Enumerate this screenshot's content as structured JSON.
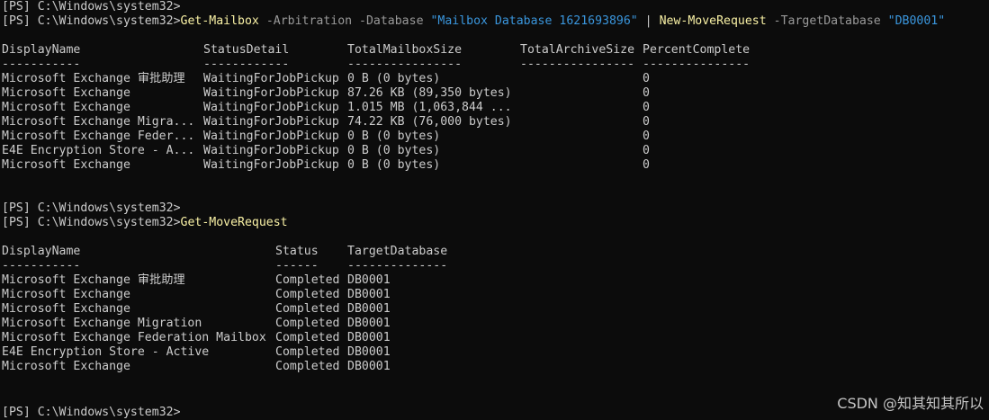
{
  "prompt": {
    "ps_tag": "[PS]",
    "path": "C:\\Windows\\system32>"
  },
  "command1": {
    "cmdlet1": "Get-Mailbox",
    "param1": "-Arbitration",
    "param2": "-Database",
    "arg1": "\"Mailbox Database 1621693896\"",
    "pipe": "|",
    "cmdlet2": "New-MoveRequest",
    "param3": "-TargetDatabase",
    "arg2": "\"DB0001\""
  },
  "table1": {
    "headers": [
      "DisplayName",
      "StatusDetail",
      "TotalMailboxSize",
      "TotalArchiveSize",
      "PercentComplete"
    ],
    "separators": [
      "-----------",
      "------------",
      "----------------",
      "----------------",
      "---------------"
    ],
    "rows": [
      [
        "Microsoft Exchange 审批助理",
        "WaitingForJobPickup",
        "0 B (0 bytes)",
        "",
        "0"
      ],
      [
        "Microsoft Exchange",
        "WaitingForJobPickup",
        "87.26 KB (89,350 bytes)",
        "",
        "0"
      ],
      [
        "Microsoft Exchange",
        "WaitingForJobPickup",
        "1.015 MB (1,063,844 ...",
        "",
        "0"
      ],
      [
        "Microsoft Exchange Migra...",
        "WaitingForJobPickup",
        "74.22 KB (76,000 bytes)",
        "",
        "0"
      ],
      [
        "Microsoft Exchange Feder...",
        "WaitingForJobPickup",
        "0 B (0 bytes)",
        "",
        "0"
      ],
      [
        "E4E Encryption Store - A...",
        "WaitingForJobPickup",
        "0 B (0 bytes)",
        "",
        "0"
      ],
      [
        "Microsoft Exchange",
        "WaitingForJobPickup",
        "0 B (0 bytes)",
        "",
        "0"
      ]
    ]
  },
  "command2": {
    "cmdlet": "Get-MoveRequest"
  },
  "table2": {
    "headers": [
      "DisplayName",
      "Status",
      "TargetDatabase"
    ],
    "separators": [
      "-----------",
      "------",
      "--------------"
    ],
    "rows": [
      [
        "Microsoft Exchange 审批助理",
        "Completed",
        "DB0001"
      ],
      [
        "Microsoft Exchange",
        "Completed",
        "DB0001"
      ],
      [
        "Microsoft Exchange",
        "Completed",
        "DB0001"
      ],
      [
        "Microsoft Exchange Migration",
        "Completed",
        "DB0001"
      ],
      [
        "Microsoft Exchange Federation Mailbox",
        "Completed",
        "DB0001"
      ],
      [
        "E4E Encryption Store - Active",
        "Completed",
        "DB0001"
      ],
      [
        "Microsoft Exchange",
        "Completed",
        "DB0001"
      ]
    ]
  },
  "watermark": "CSDN @知其知其所以",
  "colors": {
    "background": "#0c0c0c",
    "text": "#cccccc",
    "cmdlet": "#f9f1a5",
    "parameter": "#9a9a9a",
    "string": "#3a96dd"
  }
}
